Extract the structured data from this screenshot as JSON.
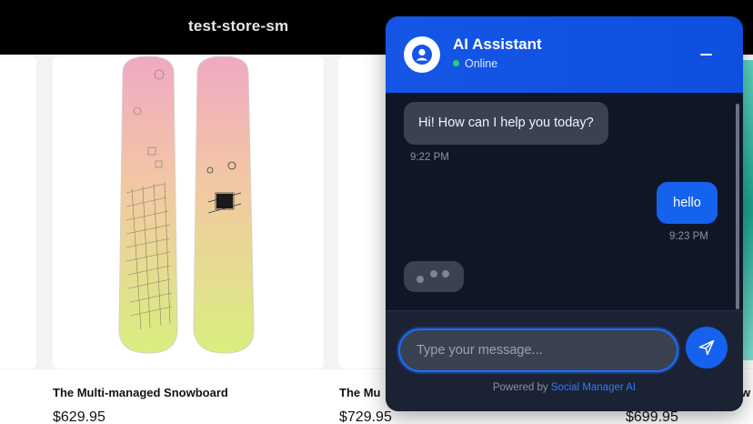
{
  "store": {
    "title": "test-store-sm"
  },
  "products": [
    {
      "name": "The Multi-managed Snowboard",
      "price": "$629.95"
    },
    {
      "name": "The Mu",
      "price": "$729.95"
    },
    {
      "name": "w",
      "price": "$699.95"
    }
  ],
  "chat": {
    "assistant_name": "AI Assistant",
    "status": "Online",
    "status_color": "#27d46b",
    "header_color": "#1556e6",
    "messages": [
      {
        "sender": "bot",
        "text": "Hi! How can I help you today?",
        "time": "9:22 PM"
      },
      {
        "sender": "user",
        "text": "hello",
        "time": "9:23 PM"
      }
    ],
    "typing_indicator": true,
    "input": {
      "placeholder": "Type your message...",
      "value": ""
    },
    "powered_by_prefix": "Powered by",
    "powered_by_link": "Social Manager AI",
    "icons": {
      "avatar": "user-circle-icon",
      "minimize": "minus-icon",
      "send": "paper-plane-icon"
    }
  }
}
